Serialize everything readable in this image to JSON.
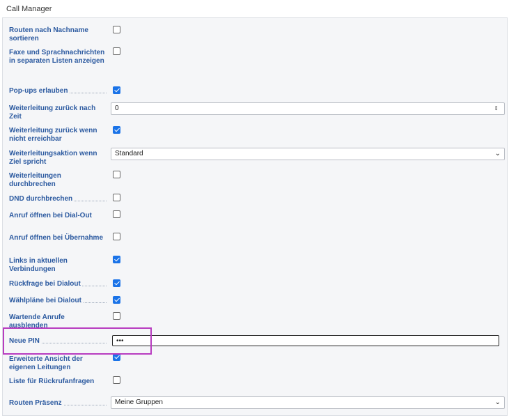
{
  "panel": {
    "title": "Call Manager"
  },
  "settings": [
    {
      "label": "Routen nach Nachname sortieren",
      "type": "checkbox",
      "checked": false
    },
    {
      "label": "Faxe und Sprachnachrichten in separaten Listen anzeigen",
      "type": "checkbox",
      "checked": false
    },
    {
      "label": "Pop-ups erlauben",
      "type": "checkbox",
      "checked": true
    },
    {
      "label": "Weiterleitung zurück nach Zeit",
      "type": "number",
      "value": "0"
    },
    {
      "label": "Weiterleitung zurück wenn nicht erreichbar",
      "type": "checkbox",
      "checked": true
    },
    {
      "label": "Weiterleitungsaktion wenn Ziel spricht",
      "type": "select",
      "value": "Standard"
    },
    {
      "label": "Weiterleitungen durchbrechen",
      "type": "checkbox",
      "checked": false
    },
    {
      "label": "DND durchbrechen",
      "type": "checkbox",
      "checked": false
    },
    {
      "label": "Anruf öffnen bei Dial-Out",
      "type": "checkbox",
      "checked": false
    },
    {
      "label": "Anruf öffnen bei Übernahme",
      "type": "checkbox",
      "checked": false
    },
    {
      "label": "Links in aktuellen Verbindungen",
      "type": "checkbox",
      "checked": true
    },
    {
      "label": "Rückfrage bei Dialout",
      "type": "checkbox",
      "checked": true
    },
    {
      "label": "Wählpläne bei Dialout",
      "type": "checkbox",
      "checked": true
    },
    {
      "label": "Wartende Anrufe ausblenden",
      "type": "checkbox",
      "checked": false
    },
    {
      "label": "Neue PIN",
      "type": "password",
      "value": "•••"
    },
    {
      "label": "Erweiterte Ansicht der eigenen Leitungen",
      "type": "checkbox",
      "checked": true
    },
    {
      "label": "Liste für Rückrufanfragen",
      "type": "checkbox",
      "checked": false
    },
    {
      "label": "Routen Präsenz",
      "type": "select",
      "value": "Meine Gruppen"
    }
  ],
  "colors": {
    "label": "#2c5aa0",
    "checkbox_checked": "#1a73e8",
    "highlight": "#b83cc0"
  },
  "icons": {
    "select": "chevron-down-icon",
    "spinner": "spinner-icon"
  }
}
